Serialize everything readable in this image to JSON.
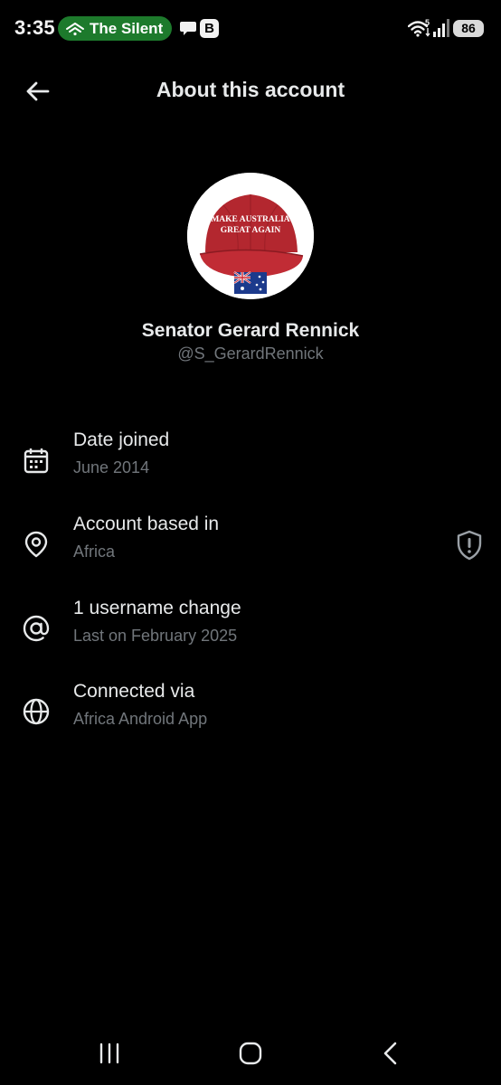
{
  "status_bar": {
    "time": "3:35",
    "media_pill": {
      "text": "The Silent",
      "icon": "podcast-wave-icon",
      "color": "#1d7a2c"
    },
    "notification_icons": [
      "chat-bubble-icon",
      "b-app-icon"
    ],
    "b_app_label": "B",
    "wifi_label": "5",
    "battery": "86"
  },
  "header": {
    "back_icon": "arrow-left-icon",
    "title": "About this account"
  },
  "profile": {
    "avatar_icon": "maga-style-cap-image",
    "cap_text_line1": "MAKE AUSTRALIA",
    "cap_text_line2": "GREAT AGAIN",
    "name": "Senator Gerard Rennick",
    "handle": "@S_GerardRennick"
  },
  "info": [
    {
      "icon": "calendar-icon",
      "title": "Date joined",
      "subtitle": "June 2014"
    },
    {
      "icon": "location-pin-icon",
      "title": "Account based in",
      "subtitle": "Africa",
      "trailing_icon": "shield-alert-icon"
    },
    {
      "icon": "at-sign-icon",
      "title": "1 username change",
      "subtitle": "Last on February 2025"
    },
    {
      "icon": "globe-icon",
      "title": "Connected via",
      "subtitle": "Africa Android App"
    }
  ],
  "nav_bar": {
    "buttons": [
      "recent-apps-icon",
      "home-icon",
      "back-chevron-icon"
    ]
  },
  "colors": {
    "background": "#000000",
    "primary_text": "#e7e9ea",
    "secondary_text": "#71767b",
    "cap_red": "#b3272f"
  }
}
